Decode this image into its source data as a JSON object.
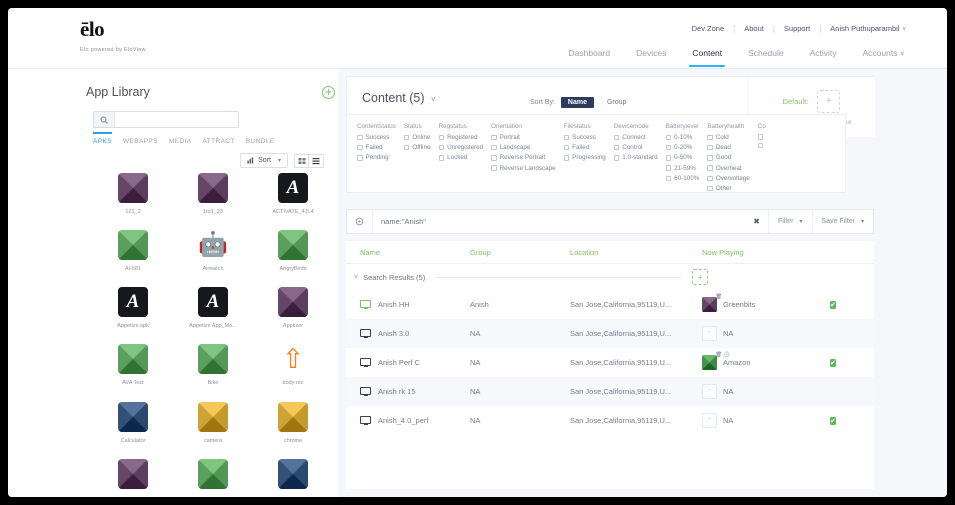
{
  "brand": {
    "logo_text": "ēlo",
    "tagline": "Elo powered by EloView"
  },
  "utility_nav": {
    "items": [
      {
        "label": "Dev Zone"
      },
      {
        "label": "About"
      },
      {
        "label": "Support"
      },
      {
        "label": "Anish Puthuparambil"
      }
    ],
    "separator": "|",
    "user_caret": "˅"
  },
  "main_nav": {
    "items": [
      {
        "label": "Dashboard",
        "active": false
      },
      {
        "label": "Devices",
        "active": false
      },
      {
        "label": "Content",
        "active": true
      },
      {
        "label": "Schedule",
        "active": false
      },
      {
        "label": "Activity",
        "active": false
      },
      {
        "label": "Accounts",
        "active": false,
        "caret": "˅"
      }
    ],
    "active_color": "#29b6f6"
  },
  "app_library": {
    "title": "App Library",
    "add_icon": "+",
    "search": {
      "icon": "search-icon",
      "value": "",
      "placeholder": ""
    },
    "tabs": [
      {
        "label": "APKS",
        "active": true
      },
      {
        "label": "WEBAPPS",
        "active": false
      },
      {
        "label": "MEDIA",
        "active": false
      },
      {
        "label": "ATTRACT",
        "active": false
      },
      {
        "label": "BUNDLE",
        "active": false
      }
    ],
    "sort_label": "Sort",
    "sort_caret": "▾",
    "view_grid_icon": "grid-view-icon",
    "view_list_icon": "list-view-icon",
    "apps": [
      {
        "label": "121_2",
        "style": "facet",
        "color": "#5a2d5e",
        "glyph": ""
      },
      {
        "label": "1to1_23",
        "style": "facet",
        "color": "#5a2d5e",
        "glyph": ""
      },
      {
        "label": "ACTIVATE_4.5.4",
        "style": "logoA",
        "color": "#16181c",
        "glyph": "A"
      },
      {
        "label": "Al-681",
        "style": "facet",
        "color": "#4caf50",
        "glyph": ""
      },
      {
        "label": "Airwatch",
        "style": "android",
        "color": "#ffffff",
        "glyph": "android-icon"
      },
      {
        "label": "AngryBirds",
        "style": "facet",
        "color": "#4caf50",
        "glyph": ""
      },
      {
        "label": "Appetize apk",
        "style": "logoA",
        "color": "#16181c",
        "glyph": "A"
      },
      {
        "label": "Appetize App_Me...",
        "style": "logoA",
        "color": "#16181c",
        "glyph": "A"
      },
      {
        "label": "Apptizer",
        "style": "facet",
        "color": "#5a2d5e",
        "glyph": ""
      },
      {
        "label": "AVA Test",
        "style": "facet",
        "color": "#4caf50",
        "glyph": ""
      },
      {
        "label": "Bike",
        "style": "facet",
        "color": "#4caf50",
        "glyph": ""
      },
      {
        "label": "body rec",
        "style": "arrow",
        "color": "#ffffff",
        "glyph": "arrow-up-icon"
      },
      {
        "label": "Calculator",
        "style": "facet",
        "color": "#123d73",
        "glyph": ""
      },
      {
        "label": "camera",
        "style": "facet",
        "color": "#f2b417",
        "glyph": ""
      },
      {
        "label": "chrome",
        "style": "facet",
        "color": "#f2b417",
        "glyph": ""
      },
      {
        "label": "",
        "style": "facet",
        "color": "#5a2d5e",
        "glyph": ""
      },
      {
        "label": "",
        "style": "facet",
        "color": "#4caf50",
        "glyph": ""
      },
      {
        "label": "",
        "style": "facet",
        "color": "#123d73",
        "glyph": ""
      }
    ]
  },
  "content_panel": {
    "title": "Content (5)",
    "title_caret": "˅",
    "sort_by_label": "Sort By:",
    "sort_options": [
      {
        "label": "Name",
        "active": true
      },
      {
        "label": "Group",
        "active": false
      }
    ],
    "default_label": "Default:",
    "default_drop_icon": "+",
    "default_hint": "Drag content here to set as default"
  },
  "filters": {
    "columns": [
      {
        "title": "Contentstatus",
        "items": [
          "Success",
          "Failed",
          "Pending"
        ]
      },
      {
        "title": "Status",
        "items": [
          "Online",
          "Offline"
        ]
      },
      {
        "title": "Regstatus",
        "items": [
          "Registered",
          "Unregistered",
          "Locked"
        ]
      },
      {
        "title": "Orientation",
        "items": [
          "Portrait",
          "Landscape",
          "Reverse Portrait",
          "Reverse Landscape"
        ]
      },
      {
        "title": "Filestatus",
        "items": [
          "Success",
          "Failed",
          "Progressing"
        ]
      },
      {
        "title": "Devicemode",
        "items": [
          "Connect",
          "Control",
          "1.0-standard"
        ]
      },
      {
        "title": "Batterylevel",
        "items": [
          "0-10%",
          "0-20%",
          "0-50%",
          "21-59%",
          "60-100%"
        ]
      },
      {
        "title": "Batteryhealth",
        "items": [
          "Cold",
          "Dead",
          "Good",
          "Overheat",
          "Overvoltage",
          "Other"
        ]
      },
      {
        "title": "Co",
        "items": [
          "",
          ""
        ]
      }
    ]
  },
  "search_bar": {
    "icon": "target-icon",
    "value": "name:\"Anish\"",
    "placeholder": "",
    "clear_icon": "✖",
    "filter_label": "Filter",
    "filter_caret": "▾",
    "save_filter_label": "Save Filter",
    "save_filter_caret": "▾"
  },
  "table": {
    "headers": {
      "name": "Name",
      "group": "Group",
      "location": "Location",
      "now_playing": "Now Playing"
    },
    "header_color": "#7fbf67",
    "group_row": {
      "caret": "˅",
      "label": "Search Results (5)",
      "add_icon": "+"
    },
    "rows": [
      {
        "icon": "monitor-icon-online",
        "name": "Anish HH",
        "group": "Anish",
        "location": "San Jose,California,95119,U...",
        "now_playing": "Greenbits",
        "thumb_color": "#5a2d5e",
        "thumb_empty": false,
        "badge_trash": "trash-icon",
        "badge_clock": "",
        "checked": true
      },
      {
        "icon": "monitor-icon-offline",
        "name": "Anish 3.0",
        "group": "NA",
        "location": "San Jose,California,95119,U...",
        "now_playing": "NA",
        "thumb_color": "",
        "thumb_empty": true,
        "badge_trash": "",
        "badge_clock": "",
        "checked": false
      },
      {
        "icon": "monitor-icon-offline",
        "name": "Anish Perf C",
        "group": "NA",
        "location": "San Jose,California,95119,U...",
        "now_playing": "Amazon",
        "thumb_color": "#2e9e33",
        "thumb_empty": false,
        "badge_trash": "trash-icon",
        "badge_clock": "clock-icon",
        "checked": true
      },
      {
        "icon": "monitor-icon-offline",
        "name": "Anish rk 15",
        "group": "NA",
        "location": "San Jose,California,95119,U...",
        "now_playing": "NA",
        "thumb_color": "",
        "thumb_empty": true,
        "badge_trash": "",
        "badge_clock": "",
        "checked": false
      },
      {
        "icon": "monitor-icon-offline",
        "name": "Anish_4.0_perf",
        "group": "NA",
        "location": "San Jose,California,95119,U...",
        "now_playing": "NA",
        "thumb_color": "",
        "thumb_empty": true,
        "badge_trash": "",
        "badge_clock": "",
        "checked": true
      }
    ]
  }
}
